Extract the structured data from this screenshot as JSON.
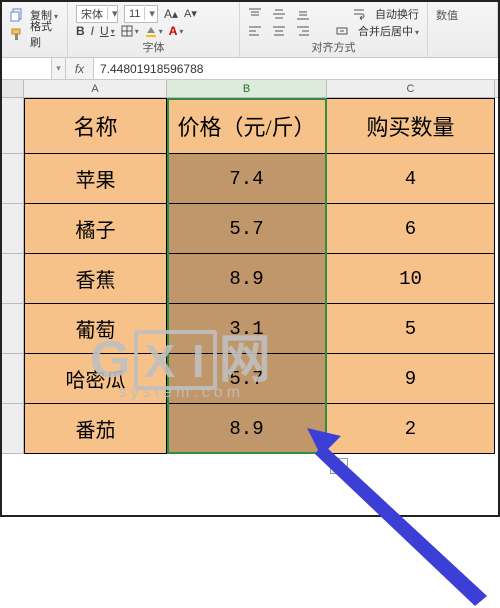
{
  "ribbon": {
    "copy_label": "复制",
    "format_painter_label": "格式刷",
    "font_name": "宋体",
    "font_size": "11",
    "group_font_label": "字体",
    "group_align_label": "对齐方式",
    "align_opt1": "自动换行",
    "align_opt2": "合并后居中",
    "num_label": "数值"
  },
  "formula_bar": {
    "name_box": "",
    "fx_label": "fx",
    "value": "7.44801918596788"
  },
  "columns": {
    "A": "A",
    "B": "B",
    "C": "C"
  },
  "table": {
    "headers": {
      "A": "名称",
      "B": "价格（元/斤）",
      "C": "购买数量"
    },
    "rows": [
      {
        "A": "苹果",
        "B": "7.4",
        "C": "4"
      },
      {
        "A": "橘子",
        "B": "5.7",
        "C": "6"
      },
      {
        "A": "香蕉",
        "B": "8.9",
        "C": "10"
      },
      {
        "A": "葡萄",
        "B": "3.1",
        "C": "5"
      },
      {
        "A": "哈密瓜",
        "B": "5.7",
        "C": "9"
      },
      {
        "A": "番茄",
        "B": "8.9",
        "C": "2"
      }
    ]
  },
  "watermark": {
    "line1_a": "G",
    "line1_b": "X I",
    "line1_c": "网",
    "line2": "system.com"
  },
  "chart_data": {
    "type": "table",
    "title": "",
    "columns": [
      "名称",
      "价格（元/斤）",
      "购买数量"
    ],
    "rows": [
      [
        "苹果",
        7.4,
        4
      ],
      [
        "橘子",
        5.7,
        6
      ],
      [
        "香蕉",
        8.9,
        10
      ],
      [
        "葡萄",
        3.1,
        5
      ],
      [
        "哈密瓜",
        5.7,
        9
      ],
      [
        "番茄",
        8.9,
        2
      ]
    ]
  }
}
